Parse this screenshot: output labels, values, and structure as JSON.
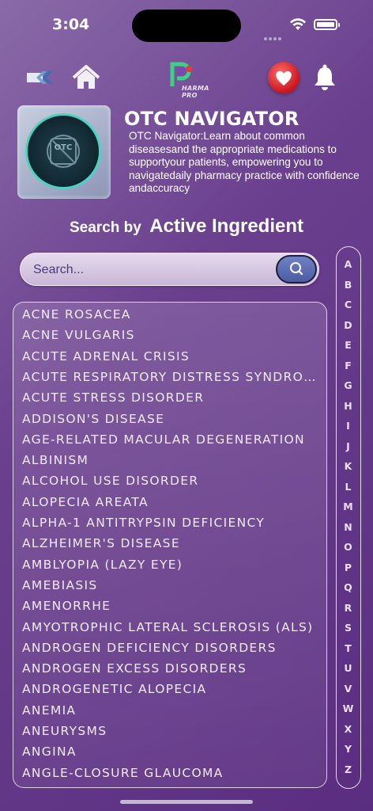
{
  "status_bar": {
    "time": "3:04"
  },
  "nav": {
    "logo_text": "HARMA PRO"
  },
  "hero": {
    "title": "OTC NAVIGATOR",
    "description": "OTC Navigator:Learn about common diseasesand the appropriate medications to supportyour patients, empowering you to navigatedaily pharmacy practice with confidence andaccuracy"
  },
  "search": {
    "label_small": "Search by",
    "label_big": "Active Ingredient",
    "placeholder": "Search..."
  },
  "list": {
    "items": [
      "ACNE ROSACEA",
      "ACNE VULGARIS",
      "ACUTE ADRENAL CRISIS",
      "ACUTE RESPIRATORY DISTRESS SYNDROME",
      "ACUTE STRESS DISORDER",
      "ADDISON'S DISEASE",
      "AGE-RELATED MACULAR DEGENERATION",
      "ALBINISM",
      "ALCOHOL USE DISORDER",
      "ALOPECIA AREATA",
      "ALPHA-1 ANTITRYPSIN DEFICIENCY",
      "ALZHEIMER'S DISEASE",
      "AMBLYOPIA (LAZY EYE)",
      "AMEBIASIS",
      "AMENORRHE",
      "AMYOTROPHIC LATERAL SCLEROSIS (ALS)",
      "ANDROGEN DEFICIENCY DISORDERS",
      "ANDROGEN EXCESS DISORDERS",
      "ANDROGENETIC ALOPECIA",
      "ANEMIA",
      "ANEURYSMS",
      "ANGINA",
      "ANGLE-CLOSURE GLAUCOMA"
    ]
  },
  "alphabet": [
    "A",
    "B",
    "C",
    "D",
    "E",
    "F",
    "G",
    "H",
    "I",
    "J",
    "K",
    "L",
    "M",
    "N",
    "O",
    "P",
    "Q",
    "R",
    "S",
    "T",
    "U",
    "V",
    "W",
    "X",
    "Y",
    "Z"
  ],
  "icons": {
    "back": "double-chevron-left-icon",
    "home": "home-icon",
    "favorite": "heart-icon",
    "notifications": "bell-icon",
    "search": "magnifier-icon"
  },
  "colors": {
    "accent": "#4c5ca4",
    "favorite": "#c9161c",
    "teal": "#49d3c2"
  }
}
